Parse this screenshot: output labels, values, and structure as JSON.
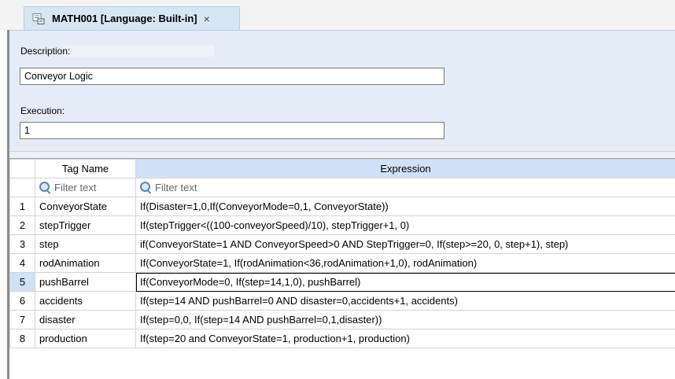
{
  "tab": {
    "title": "MATH001 [Language: Built-in]",
    "close": "×",
    "icon": "script-document-icon"
  },
  "properties": {
    "description_label": "Description:",
    "description_value": "Conveyor Logic",
    "execution_label": "Execution:",
    "execution_value": "1"
  },
  "grid": {
    "columns": [
      "Tag Name",
      "Expression"
    ],
    "filter_placeholder": "Filter text",
    "selected_row": 5,
    "rows": [
      {
        "n": "1",
        "tag": "ConveyorState",
        "expr": "If(Disaster=1,0,If(ConveyorMode=0,1, ConveyorState))"
      },
      {
        "n": "2",
        "tag": "stepTrigger",
        "expr": "If(stepTrigger<((100-conveyorSpeed)/10), stepTrigger+1, 0)"
      },
      {
        "n": "3",
        "tag": "step",
        "expr": "if(ConveyorState=1 AND ConveyorSpeed>0 AND StepTrigger=0, If(step>=20, 0, step+1), step)"
      },
      {
        "n": "4",
        "tag": "rodAnimation",
        "expr": "If(ConveyorState=1, If(rodAnimation<36,rodAnimation+1,0), rodAnimation)"
      },
      {
        "n": "5",
        "tag": "pushBarrel",
        "expr": "If(ConveyorMode=0, If(step=14,1,0), pushBarrel)"
      },
      {
        "n": "6",
        "tag": "accidents",
        "expr": "If(step=14 AND pushBarrel=0 AND disaster=0,accidents+1, accidents)"
      },
      {
        "n": "7",
        "tag": "disaster",
        "expr": "If(step=0,0, If(step=14 AND pushBarrel=0,1,disaster))"
      },
      {
        "n": "8",
        "tag": "production",
        "expr": "If(step=20 and ConveyorState=1, production+1, production)"
      }
    ]
  }
}
